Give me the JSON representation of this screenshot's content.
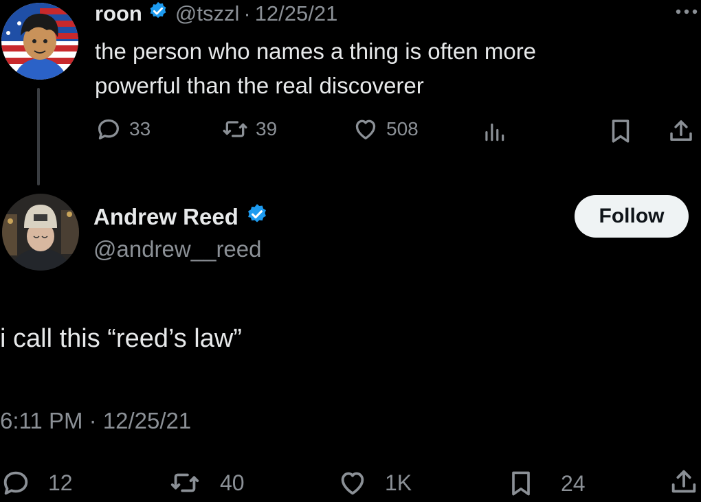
{
  "quoted": {
    "author_name": "roon",
    "handle": "@tszzl",
    "separator": "·",
    "date": "12/25/21",
    "text_line1": "the person who names a thing is often more",
    "text_line2": "powerful than the real discoverer",
    "replies": "33",
    "reposts": "39",
    "likes": "508",
    "more_icon": "ellipsis-icon"
  },
  "main": {
    "author_name": "Andrew Reed",
    "handle": "@andrew__reed",
    "follow_label": "Follow",
    "text": "i call this “reed’s law”",
    "timestamp": "6:11 PM · 12/25/21",
    "replies": "12",
    "reposts": "40",
    "likes": "1K",
    "bookmarks": "24"
  },
  "colors": {
    "background": "#000000",
    "text": "#e7e9ea",
    "muted": "#8b9096",
    "verified": "#1d9bf0",
    "follow_button": "#eff3f4"
  }
}
